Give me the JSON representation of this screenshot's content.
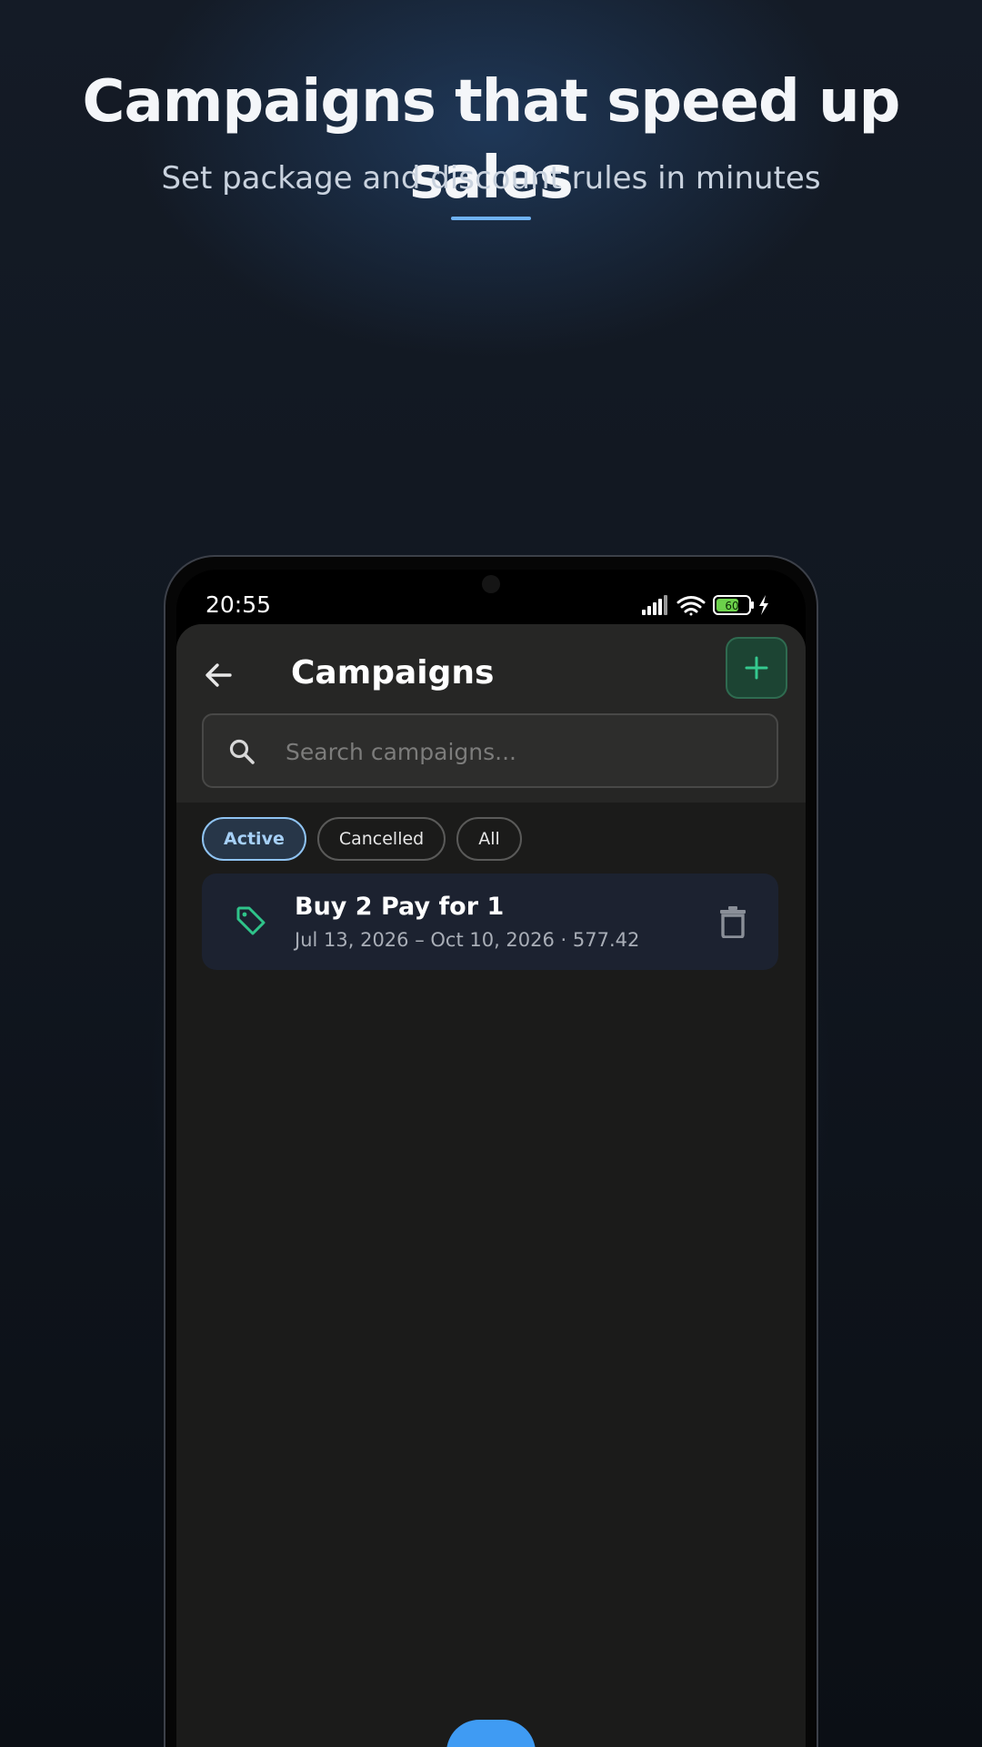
{
  "hero": {
    "title": "Campaigns that speed up sales",
    "subtitle": "Set package and discount rules in minutes"
  },
  "status_bar": {
    "time": "20:55",
    "battery": "60",
    "icons": [
      "signal-icon",
      "wifi-icon",
      "battery-icon",
      "charging-icon"
    ]
  },
  "app": {
    "title": "Campaigns",
    "back_icon": "arrow-left-icon",
    "add_icon": "plus-icon",
    "search": {
      "placeholder": "Search campaigns...",
      "value": ""
    },
    "filters": [
      {
        "label": "Active",
        "selected": true
      },
      {
        "label": "Cancelled",
        "selected": false
      },
      {
        "label": "All",
        "selected": false
      }
    ],
    "campaigns": [
      {
        "name": "Buy 2 Pay for 1",
        "meta": "Jul 13, 2026 – Oct 10, 2026 · 577.42",
        "icon": "tag-icon",
        "action_icon": "trash-icon"
      }
    ]
  },
  "colors": {
    "accent_blue": "#3f9bf3",
    "accent_green": "#2fc48a",
    "chip_active": "#8fc3f2",
    "surface": "#1b1b1a",
    "card": "#1c2230"
  }
}
